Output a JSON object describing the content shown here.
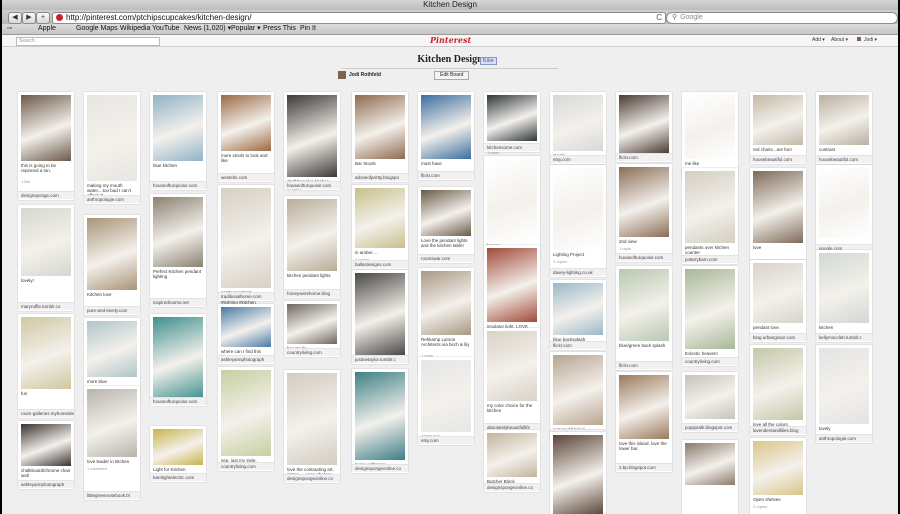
{
  "window": {
    "title": "Kitchen Design"
  },
  "toolbar": {
    "back": "◀",
    "forward": "▶",
    "add": "+",
    "url": "http://pinterest.com/ptchipscupcakes/kitchen-design/",
    "refresh": "C",
    "search_placeholder": "Google"
  },
  "bookmarks": [
    "Apple",
    "Google Maps",
    "Wikipedia",
    "YouTube",
    "News (1,020) ▾",
    "Popular ▾",
    "Press This",
    "Pin It"
  ],
  "pinterest": {
    "search_placeholder": "Search",
    "logo": "Pinterest",
    "nav": {
      "add": "Add ▾",
      "about": "About ▾",
      "user": "Jodi ▾"
    }
  },
  "board": {
    "title": "Kitchen Design",
    "like": "fLike",
    "owner": "Jodi Rothfeld",
    "edit": "Edit Board"
  },
  "pins": [
    {
      "id": "c1a",
      "cap": "this is going to be repinned a ton.",
      "sub": "1 like",
      "src": "designsponge.com",
      "col": "#6c5a4a"
    },
    {
      "id": "c1b",
      "cap": "lovely!",
      "sub": "",
      "src": "maryruffle.tumblr.co",
      "col": "#d6d6d0"
    },
    {
      "id": "c1c",
      "cap": "fun",
      "sub": "",
      "src": "room-galleries.myhomeide",
      "col": "#cfc8a0"
    },
    {
      "id": "c1d",
      "cap": "chalkboard/chrome chair wall",
      "sub": "",
      "src": "ashleyannphotograph",
      "col": "#3a3230"
    },
    {
      "id": "c2a",
      "cap": "making my mouth water....too bad I can't afford it!",
      "sub": "",
      "src": "anthropologie.com",
      "col": "#e8e6e2"
    },
    {
      "id": "c2b",
      "cap": "Kitchen love",
      "sub": "",
      "src": "pure-and-lovely.com",
      "col": "#a89478"
    },
    {
      "id": "c2c",
      "cap": "more blue",
      "sub": "",
      "src": "apartmenttherapy.co",
      "col": "#b0c4c8"
    },
    {
      "id": "c2d",
      "cap": "kitchen",
      "sub": "",
      "src": "apartmenttherapy.com",
      "col": "#c8c2b4"
    },
    {
      "id": "c2e",
      "cap": "love leader in kitchen",
      "sub": "1 comment",
      "src": "littlegreennotebook.bl",
      "col": "#b8b4ac"
    },
    {
      "id": "c3a",
      "cap": "blue kitchen",
      "sub": "",
      "src": "houseofturquoise.com",
      "col": "#8fb2c6"
    },
    {
      "id": "c3b",
      "cap": "Perfect Kitchen pendant lighting",
      "sub": "",
      "src": "inspiredrooms.net",
      "col": "#8a8272"
    },
    {
      "id": "c3c",
      "cap": "love this island",
      "sub": "",
      "src": "houseofturquoise.com",
      "col": "#3e8f8c"
    },
    {
      "id": "c3d",
      "cap": "Light for Kitchen",
      "sub": "",
      "src": "barnlightelectric.com",
      "col": "#c9b34a"
    },
    {
      "id": "c4a",
      "cap": "more stools to look and like",
      "sub": "",
      "src": "westelm.com",
      "col": "#9a6a44"
    },
    {
      "id": "c4b",
      "cap": "pretty pendants #Vintageinspired #lighting #kitchen",
      "sub": "",
      "src": "traditionalhome.com",
      "col": "#d6d0c4"
    },
    {
      "id": "c4c",
      "cap": "where can I find this blue?",
      "sub": "",
      "src": "ashleyannphotograph",
      "col": "#4a7aa6"
    },
    {
      "id": "c4d",
      "cap": "yep, just my style.",
      "sub": "1 repin 1 like",
      "src": "countryliving.com",
      "col": "#c7cfa0"
    },
    {
      "id": "c5a",
      "cap": "chalkboard in kitchen",
      "sub": "3 repins",
      "src": "houseofturquoise.com",
      "col": "#3c3a36"
    },
    {
      "id": "c5b",
      "cap": "kitchen pendant lights",
      "sub": "",
      "src": "honeywerehome.blog",
      "col": "#b8ad98"
    },
    {
      "id": "c5c",
      "cap": "bar stools",
      "sub": "",
      "src": "countryliving.com",
      "col": "#6e6660"
    },
    {
      "id": "c5d",
      "cap": "love the contrasting art, plates.....open shelves.",
      "sub": "",
      "src": "designspongeonline.co",
      "col": "#d2ccc0"
    },
    {
      "id": "c6a",
      "cap": "Bar Stools",
      "sub": "",
      "src": "adoseofpretty.blogspo",
      "col": "#8e6a50"
    },
    {
      "id": "c6b",
      "cap": "in amber....",
      "sub": "2 repins",
      "src": "ballardesigns.com",
      "col": "#c6c08a"
    },
    {
      "id": "c6c",
      "cap": "contrast",
      "sub": "",
      "src": "justinetaylor.tumblr.c",
      "col": "#4a4844"
    },
    {
      "id": "c6d",
      "cap": "more wallpaper",
      "sub": "",
      "src": "designspongeonline.co",
      "col": "#3d7f86"
    },
    {
      "id": "c7a",
      "cap": "must have",
      "sub": "",
      "src": "flickr.com",
      "col": "#3b6e9e"
    },
    {
      "id": "c7b",
      "cap": "Love the pendant lights and the kitchen table!",
      "sub": "",
      "src": "roomswar.com",
      "col": "#6a5a48"
    },
    {
      "id": "c7c",
      "cap": "Rehkamp Larson Architects via birch & lily",
      "sub": "1 repin",
      "src": "justinetaylor.tumblr.c",
      "col": "#a89884"
    },
    {
      "id": "c7d",
      "cap": "gorgeous.",
      "sub": "",
      "src": "etsy.com",
      "col": "#e6e6e6"
    },
    {
      "id": "c8a",
      "cap": "Kitchen",
      "sub": "1 repin",
      "src": "kitchensome.com",
      "col": "#2e3538"
    },
    {
      "id": "c8b",
      "cap": "hmmm",
      "sub": "",
      "src": "promto.com",
      "col": "#ffffff"
    },
    {
      "id": "c8c",
      "cap": "insulator light. LOVE 'em!",
      "sub": "1 repin",
      "src": "napastyle.com",
      "col": "#a04a38"
    },
    {
      "id": "c8d",
      "cap": "my color choice for the kitchen",
      "sub": "",
      "src": "absolutelybeautifullife",
      "col": "#d8d2c6"
    },
    {
      "id": "c8e",
      "cap": "Butcher Block",
      "sub": "",
      "src": "designspongeonline.co",
      "col": "#c2b49c"
    },
    {
      "id": "c9a",
      "cap": "stools",
      "sub": "",
      "src": "etsy.com",
      "col": "#d8d8d8"
    },
    {
      "id": "c9b",
      "cap": "Lighting Project",
      "sub": "2 repins",
      "src": "davey-lighting.co.uk",
      "col": "#ffffff"
    },
    {
      "id": "c9c",
      "cap": "blue backsplash",
      "sub": "",
      "src": "flickr.com",
      "col": "#9ab8c8"
    },
    {
      "id": "c9d",
      "cap": "exposed brick is amazing. wish I could have it in my kitchen :(",
      "sub": "",
      "src": "blog.urbangrace.com",
      "col": "#b8a492"
    },
    {
      "id": "c9e",
      "cap": "",
      "sub": "",
      "src": "",
      "col": "#5a4436"
    },
    {
      "id": "c10a",
      "cap": "LOVE",
      "sub": "",
      "src": "flickr.com",
      "col": "#4a3c34"
    },
    {
      "id": "c10b",
      "cap": "2nd view",
      "sub": "1 repin",
      "src": "houseofturquoise.com",
      "col": "#8a6e56"
    },
    {
      "id": "c10c",
      "cap": "blue/green back splash",
      "sub": "",
      "src": "flickr.com",
      "col": "#b8c8b0"
    },
    {
      "id": "c10d",
      "cap": "love this island. love the lower bar.",
      "sub": "",
      "src": "2.bp.blogspot.com",
      "col": "#9a7a5a"
    },
    {
      "id": "c11a",
      "cap": "me like",
      "sub": "",
      "src": "urbanremainschicago",
      "col": "#ffffff"
    },
    {
      "id": "c11b",
      "cap": "pendants over kitchen counter",
      "sub": "",
      "src": "potterybarn.com",
      "col": "#d4cec2"
    },
    {
      "id": "c11c",
      "cap": "Eclectic heaven!",
      "sub": "",
      "src": "countryliving.com",
      "col": "#a8b898"
    },
    {
      "id": "c11d",
      "cap": "",
      "sub": "",
      "src": "poppytalk.blogspot.com",
      "col": "#c6c2bc"
    },
    {
      "id": "c11e",
      "cap": "",
      "sub": "",
      "src": "",
      "col": "#8a7a6a"
    },
    {
      "id": "c12a",
      "cap": "red chairs...are fun!",
      "sub": "",
      "src": "housebeautiful.com",
      "col": "#c4b8a8"
    },
    {
      "id": "c12b",
      "cap": "love",
      "sub": "",
      "src": "housebeautiful.com",
      "col": "#7e6a58"
    },
    {
      "id": "c12c",
      "cap": "pendant love.",
      "sub": "1 like",
      "src": "blog.urbangrace.com",
      "col": "#d8d4cc"
    },
    {
      "id": "c12d",
      "cap": "love all the colors.",
      "sub": "",
      "src": "lavendersandlilies.blog",
      "col": "#c4c8a8"
    },
    {
      "id": "c12e",
      "cap": "Open shelves",
      "sub": "2 repins",
      "src": "",
      "col": "#d8c68a"
    },
    {
      "id": "c13a",
      "cap": "contrast",
      "sub": "",
      "src": "housebeautiful.com",
      "col": "#b8b0a0"
    },
    {
      "id": "c13b",
      "cap": "",
      "sub": "",
      "src": "google.com",
      "col": "#ffffff"
    },
    {
      "id": "c13c",
      "cap": "kitchen",
      "sub": "",
      "src": "kellymoccleb.tumblr.c",
      "col": "#d2d8d2"
    },
    {
      "id": "c13d",
      "cap": "lovely",
      "sub": "",
      "src": "anthropologie.com",
      "col": "#e4e4e4"
    }
  ]
}
